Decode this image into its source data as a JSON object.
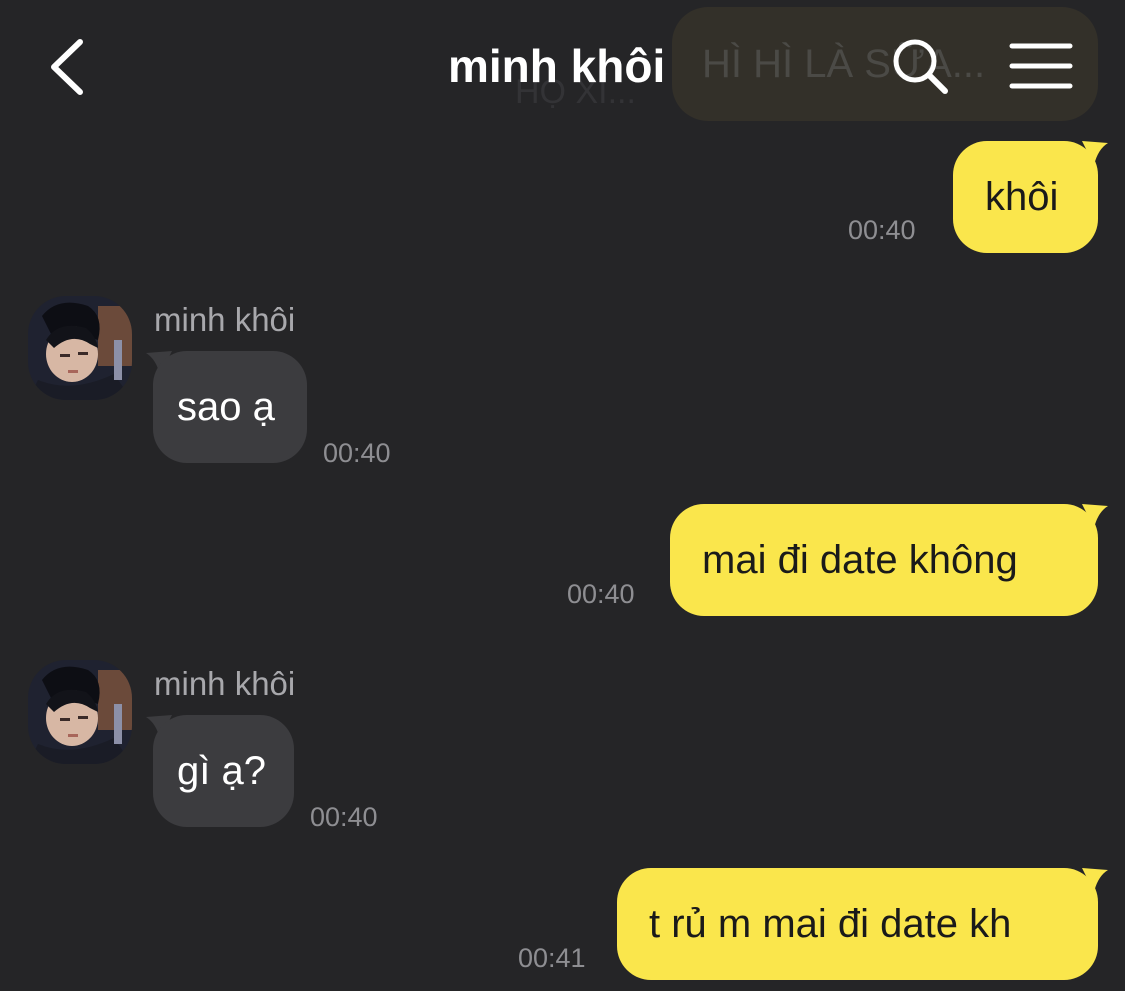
{
  "header": {
    "title": "minh khôi",
    "back_icon": "chevron-left-icon",
    "search_icon": "search-icon",
    "menu_icon": "menu-icon"
  },
  "ghost_message": {
    "text": "HÌ HÌ LÀ SỮA...",
    "lower_text": "HỌ XÍ..."
  },
  "messages": [
    {
      "direction": "out",
      "text": "khôi",
      "time": "00:40"
    },
    {
      "direction": "in",
      "sender": "minh khôi",
      "text": "sao ạ",
      "time": "00:40"
    },
    {
      "direction": "out",
      "text": "mai đi date không",
      "time": "00:40"
    },
    {
      "direction": "in",
      "sender": "minh khôi",
      "text": "gì ạ?",
      "time": "00:40"
    },
    {
      "direction": "out",
      "text": "t rủ m mai đi date kh",
      "time": "00:41"
    }
  ],
  "colors": {
    "background": "#252527",
    "outgoing_bubble": "#fae64c",
    "incoming_bubble": "#3c3c3f",
    "timestamp": "#8e8e92"
  }
}
